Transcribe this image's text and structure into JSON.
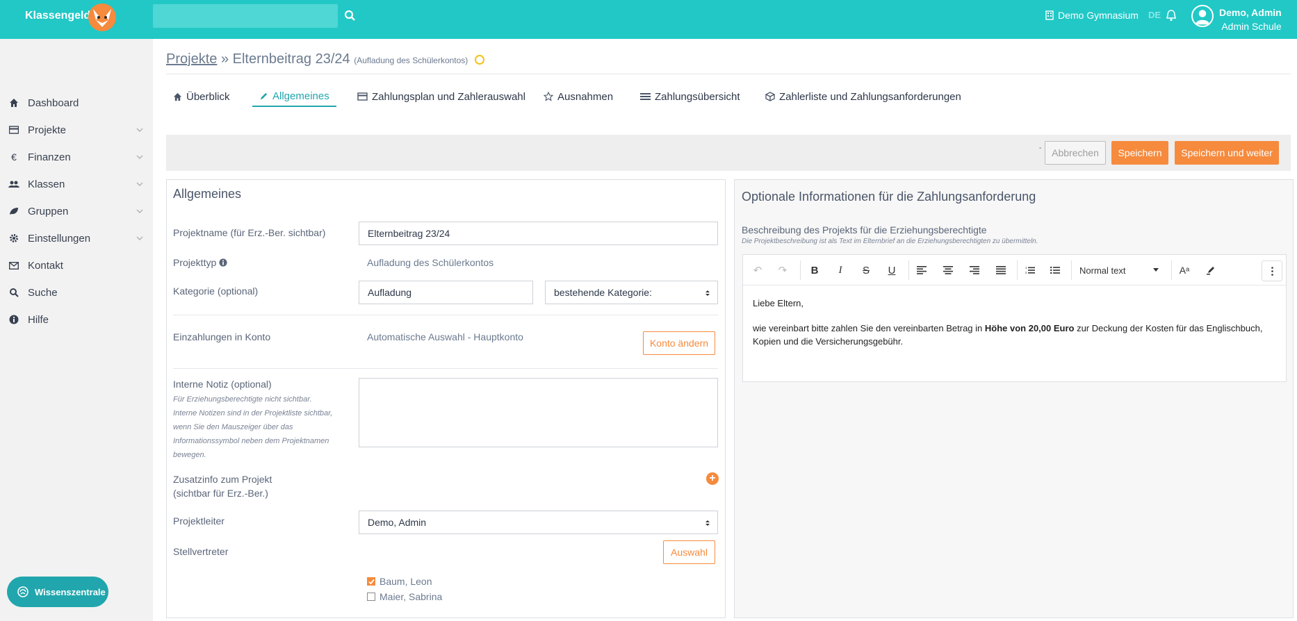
{
  "header": {
    "brand": "Klassengeld",
    "search_placeholder": "",
    "school": "Demo Gymnasium",
    "lang": "DE",
    "user_name": "Demo, Admin",
    "user_school": "Admin Schule"
  },
  "sidebar": {
    "items": [
      {
        "label": "Dashboard",
        "icon": "home-icon"
      },
      {
        "label": "Projekte",
        "icon": "card-icon",
        "expandable": true
      },
      {
        "label": "Finanzen",
        "icon": "euro-icon",
        "expandable": true
      },
      {
        "label": "Klassen",
        "icon": "users-icon",
        "expandable": true
      },
      {
        "label": "Gruppen",
        "icon": "leaf-icon",
        "expandable": true
      },
      {
        "label": "Einstellungen",
        "icon": "gear-icon",
        "expandable": true
      },
      {
        "label": "Kontakt",
        "icon": "envelope-icon"
      },
      {
        "label": "Suche",
        "icon": "search-icon"
      },
      {
        "label": "Hilfe",
        "icon": "info-icon"
      }
    ],
    "knowledge_button": "Wissenszentrale"
  },
  "breadcrumb": {
    "root": "Projekte",
    "separator": "»",
    "title": "Elternbeitrag 23/24",
    "subtitle": "(Aufladung des Schülerkontos)"
  },
  "tabs": [
    {
      "label": "Überblick",
      "icon": "home-icon"
    },
    {
      "label": "Allgemeines",
      "icon": "pencil-icon",
      "active": true
    },
    {
      "label": "Zahlungsplan und Zahlerauswahl",
      "icon": "card-icon"
    },
    {
      "label": "Ausnahmen",
      "icon": "star-icon"
    },
    {
      "label": "Zahlungsübersicht",
      "icon": "list-icon"
    },
    {
      "label": "Zahlerliste und Zahlungsanforderungen",
      "icon": "box-icon"
    }
  ],
  "actions": {
    "dash": "-",
    "cancel": "Abbrechen",
    "save": "Speichern",
    "save_next": "Speichern und weiter"
  },
  "general": {
    "heading": "Allgemeines",
    "project_name_label": "Projektname (für Erz.-Ber. sichtbar)",
    "project_name_value": "Elternbeitrag 23/24",
    "project_type_label": "Projekttyp",
    "project_type_value": "Aufladung des Schülerkontos",
    "category_label": "Kategorie (optional)",
    "category_value": "Aufladung",
    "category_select": "bestehende Kategorie:",
    "deposit_label": "Einzahlungen in Konto",
    "deposit_value": "Automatische Auswahl - Hauptkonto",
    "change_account": "Konto ändern",
    "note_label": "Interne Notiz (optional)",
    "note_help": [
      "Für Erziehungsberechtigte nicht sichtbar.",
      "Interne Notizen sind in der Projektliste sichtbar,",
      "wenn Sie den Mauszeiger über das",
      "Informationssymbol neben dem Projektnamen",
      "bewegen."
    ],
    "extra_label_1": "Zusatzinfo zum Projekt",
    "extra_label_2": "(sichtbar für Erz.-Ber.)",
    "plus": "+",
    "leader_label": "Projektleiter",
    "leader_value": "Demo, Admin",
    "deputy_label": "Stellvertreter",
    "select_button": "Auswahl",
    "deputies": [
      {
        "name": "Baum, Leon",
        "checked": true
      },
      {
        "name": "Maier, Sabrina",
        "checked": false
      }
    ]
  },
  "optional": {
    "heading": "Optionale Informationen für die Zahlungsanforderung",
    "desc_label": "Beschreibung des Projekts für die Erziehungsberechtigte",
    "desc_help": "Die Projektbeschreibung ist als Text im Elternbrief an die Erziehungsberechtigten zu übermitteln.",
    "style": "Normal text",
    "body_greeting": "Liebe Eltern,",
    "body_1": "wie vereinbart bitte zahlen Sie den vereinbarten Betrag in ",
    "body_bold": "Höhe von 20,00 Euro",
    "body_2": " zur Deckung der Kosten für das Englischbuch, Kopien und die Versicherungsgebühr."
  },
  "colors": {
    "header": "#21c8c6",
    "accent": "#21a6ad",
    "orange": "#f68a3d"
  }
}
